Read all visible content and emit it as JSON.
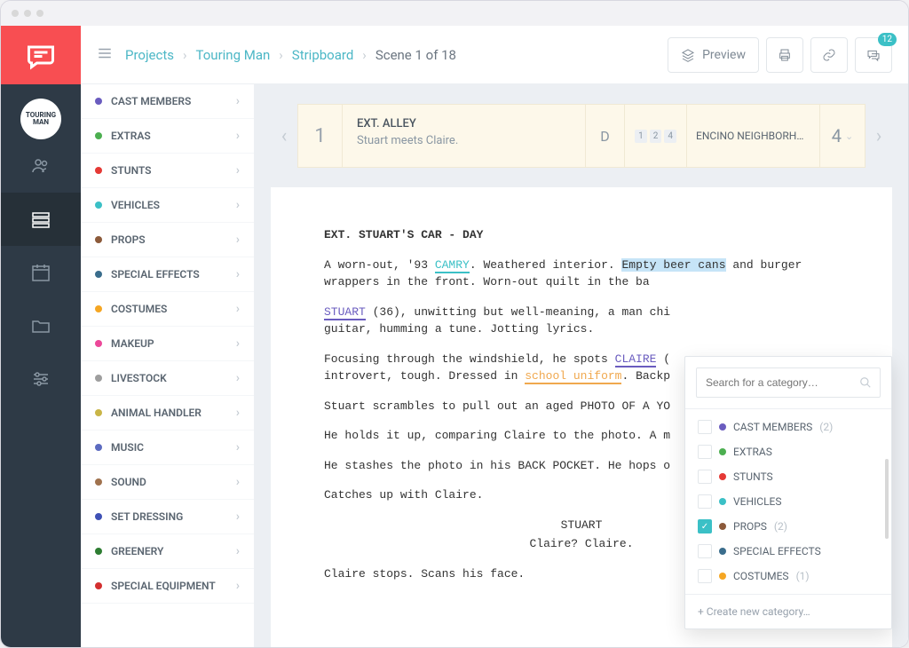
{
  "breadcrumb": {
    "projects": "Projects",
    "project": "Touring Man",
    "view": "Stripboard",
    "scene": "Scene 1 of 18"
  },
  "toolbar": {
    "preview": "Preview",
    "comment_badge": "12"
  },
  "avatar_label": "TOURING MAN",
  "sidebar": {
    "items": [
      {
        "label": "CAST MEMBERS",
        "color": "#6a5cbf"
      },
      {
        "label": "EXTRAS",
        "color": "#4caf50"
      },
      {
        "label": "STUNTS",
        "color": "#e53935"
      },
      {
        "label": "VEHICLES",
        "color": "#3bc0c6"
      },
      {
        "label": "PROPS",
        "color": "#8c5a3a"
      },
      {
        "label": "SPECIAL EFFECTS",
        "color": "#3a6d8c"
      },
      {
        "label": "COSTUMES",
        "color": "#f5a623"
      },
      {
        "label": "MAKEUP",
        "color": "#ec4899"
      },
      {
        "label": "LIVESTOCK",
        "color": "#9e9e9e"
      },
      {
        "label": "ANIMAL HANDLER",
        "color": "#c9b547"
      },
      {
        "label": "MUSIC",
        "color": "#5c6bc0"
      },
      {
        "label": "SOUND",
        "color": "#a0724e"
      },
      {
        "label": "SET DRESSING",
        "color": "#3f51b5"
      },
      {
        "label": "GREENERY",
        "color": "#2e7d32"
      },
      {
        "label": "SPECIAL EQUIPMENT",
        "color": "#d32f2f"
      }
    ]
  },
  "strip": {
    "number": "1",
    "slug": "EXT. ALLEY",
    "desc": "Stuart meets Claire.",
    "daynight": "D",
    "tags": [
      "1",
      "2",
      "4"
    ],
    "location": "ENCINO NEIGHBORH…",
    "eighths": "4"
  },
  "script": {
    "slugline": "EXT. STUART'S CAR - DAY",
    "p1a": "A worn-out, '93 ",
    "p1_vehicle": "CAMRY",
    "p1b": ". Weathered interior. ",
    "p1_prop": "Empty beer cans",
    "p1c": " and burger wrappers in the front. Worn-out quilt in the ba",
    "p2a": "STUART",
    "p2b": " (36), unwitting but well-meaning, a man chi",
    "p2c": "guitar, humming a tune. Jotting lyrics.",
    "p3a": "Focusing through the windshield, he spots ",
    "p3_cast": "CLAIRE",
    "p3b": " (",
    "p3c": "introvert, tough. Dressed in ",
    "p3_costume": "school uniform",
    "p3d": ". Backp",
    "p4": "Stuart scrambles to pull out an aged PHOTO OF A YO",
    "p5": "He holds it up, comparing Claire to the photo. A m",
    "p6": "He stashes the photo in his BACK POCKET. He hops o         in a hurry.",
    "p7": "Catches up with Claire.",
    "char": "STUART",
    "dialog": "Claire? Claire.",
    "p8": "Claire stops. Scans his face."
  },
  "popup": {
    "placeholder": "Search for a category…",
    "items": [
      {
        "label": "CAST MEMBERS",
        "color": "#6a5cbf",
        "count": "(2)",
        "checked": false
      },
      {
        "label": "EXTRAS",
        "color": "#4caf50",
        "count": "",
        "checked": false
      },
      {
        "label": "STUNTS",
        "color": "#e53935",
        "count": "",
        "checked": false
      },
      {
        "label": "VEHICLES",
        "color": "#3bc0c6",
        "count": "",
        "checked": false
      },
      {
        "label": "PROPS",
        "color": "#8c5a3a",
        "count": "(2)",
        "checked": true
      },
      {
        "label": "SPECIAL EFFECTS",
        "color": "#3a6d8c",
        "count": "",
        "checked": false
      },
      {
        "label": "COSTUMES",
        "color": "#f5a623",
        "count": "(1)",
        "checked": false
      }
    ],
    "create": "+ Create new category…"
  }
}
